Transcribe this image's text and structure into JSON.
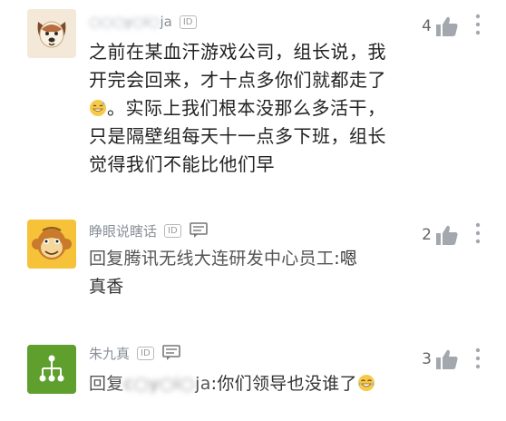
{
  "comments": [
    {
      "username_visible_suffix": "ja",
      "id_badge": "ID",
      "likes": "4",
      "text_lines": [
        "之前在某血汗游戏公司，组长说，我",
        "开完会回来，才十点多你们就都走了",
        "。实际上我们根本没那么多活干，",
        "只是隔壁组每天十一点多下班，组长",
        "觉得我们不能比他们早"
      ],
      "avatar_icon": "dog-icon"
    },
    {
      "username": "睁眼说瞎话",
      "id_badge": "ID",
      "likes": "2",
      "reply_prefix": "回复",
      "reply_target": "腾讯无线大连研发中心员工",
      "reply_sep": ":",
      "reply_text_line1": "嗯",
      "reply_text_line2": "真香",
      "avatar_icon": "monkey-icon"
    },
    {
      "username": "朱九真",
      "id_badge": "ID",
      "likes": "3",
      "reply_prefix": "回复",
      "reply_target_visible_suffix": "ja",
      "reply_sep": ":",
      "reply_text": "你们领导也没谁了",
      "avatar_icon": "network-icon"
    }
  ],
  "colors": {
    "accent_green": "#6ab03a",
    "avatar1_bg": "#f4e9d8",
    "avatar2_bg": "#f5c23a",
    "avatar3_bg": "#5f9f2e",
    "icon_gray": "#a3a8ae"
  }
}
